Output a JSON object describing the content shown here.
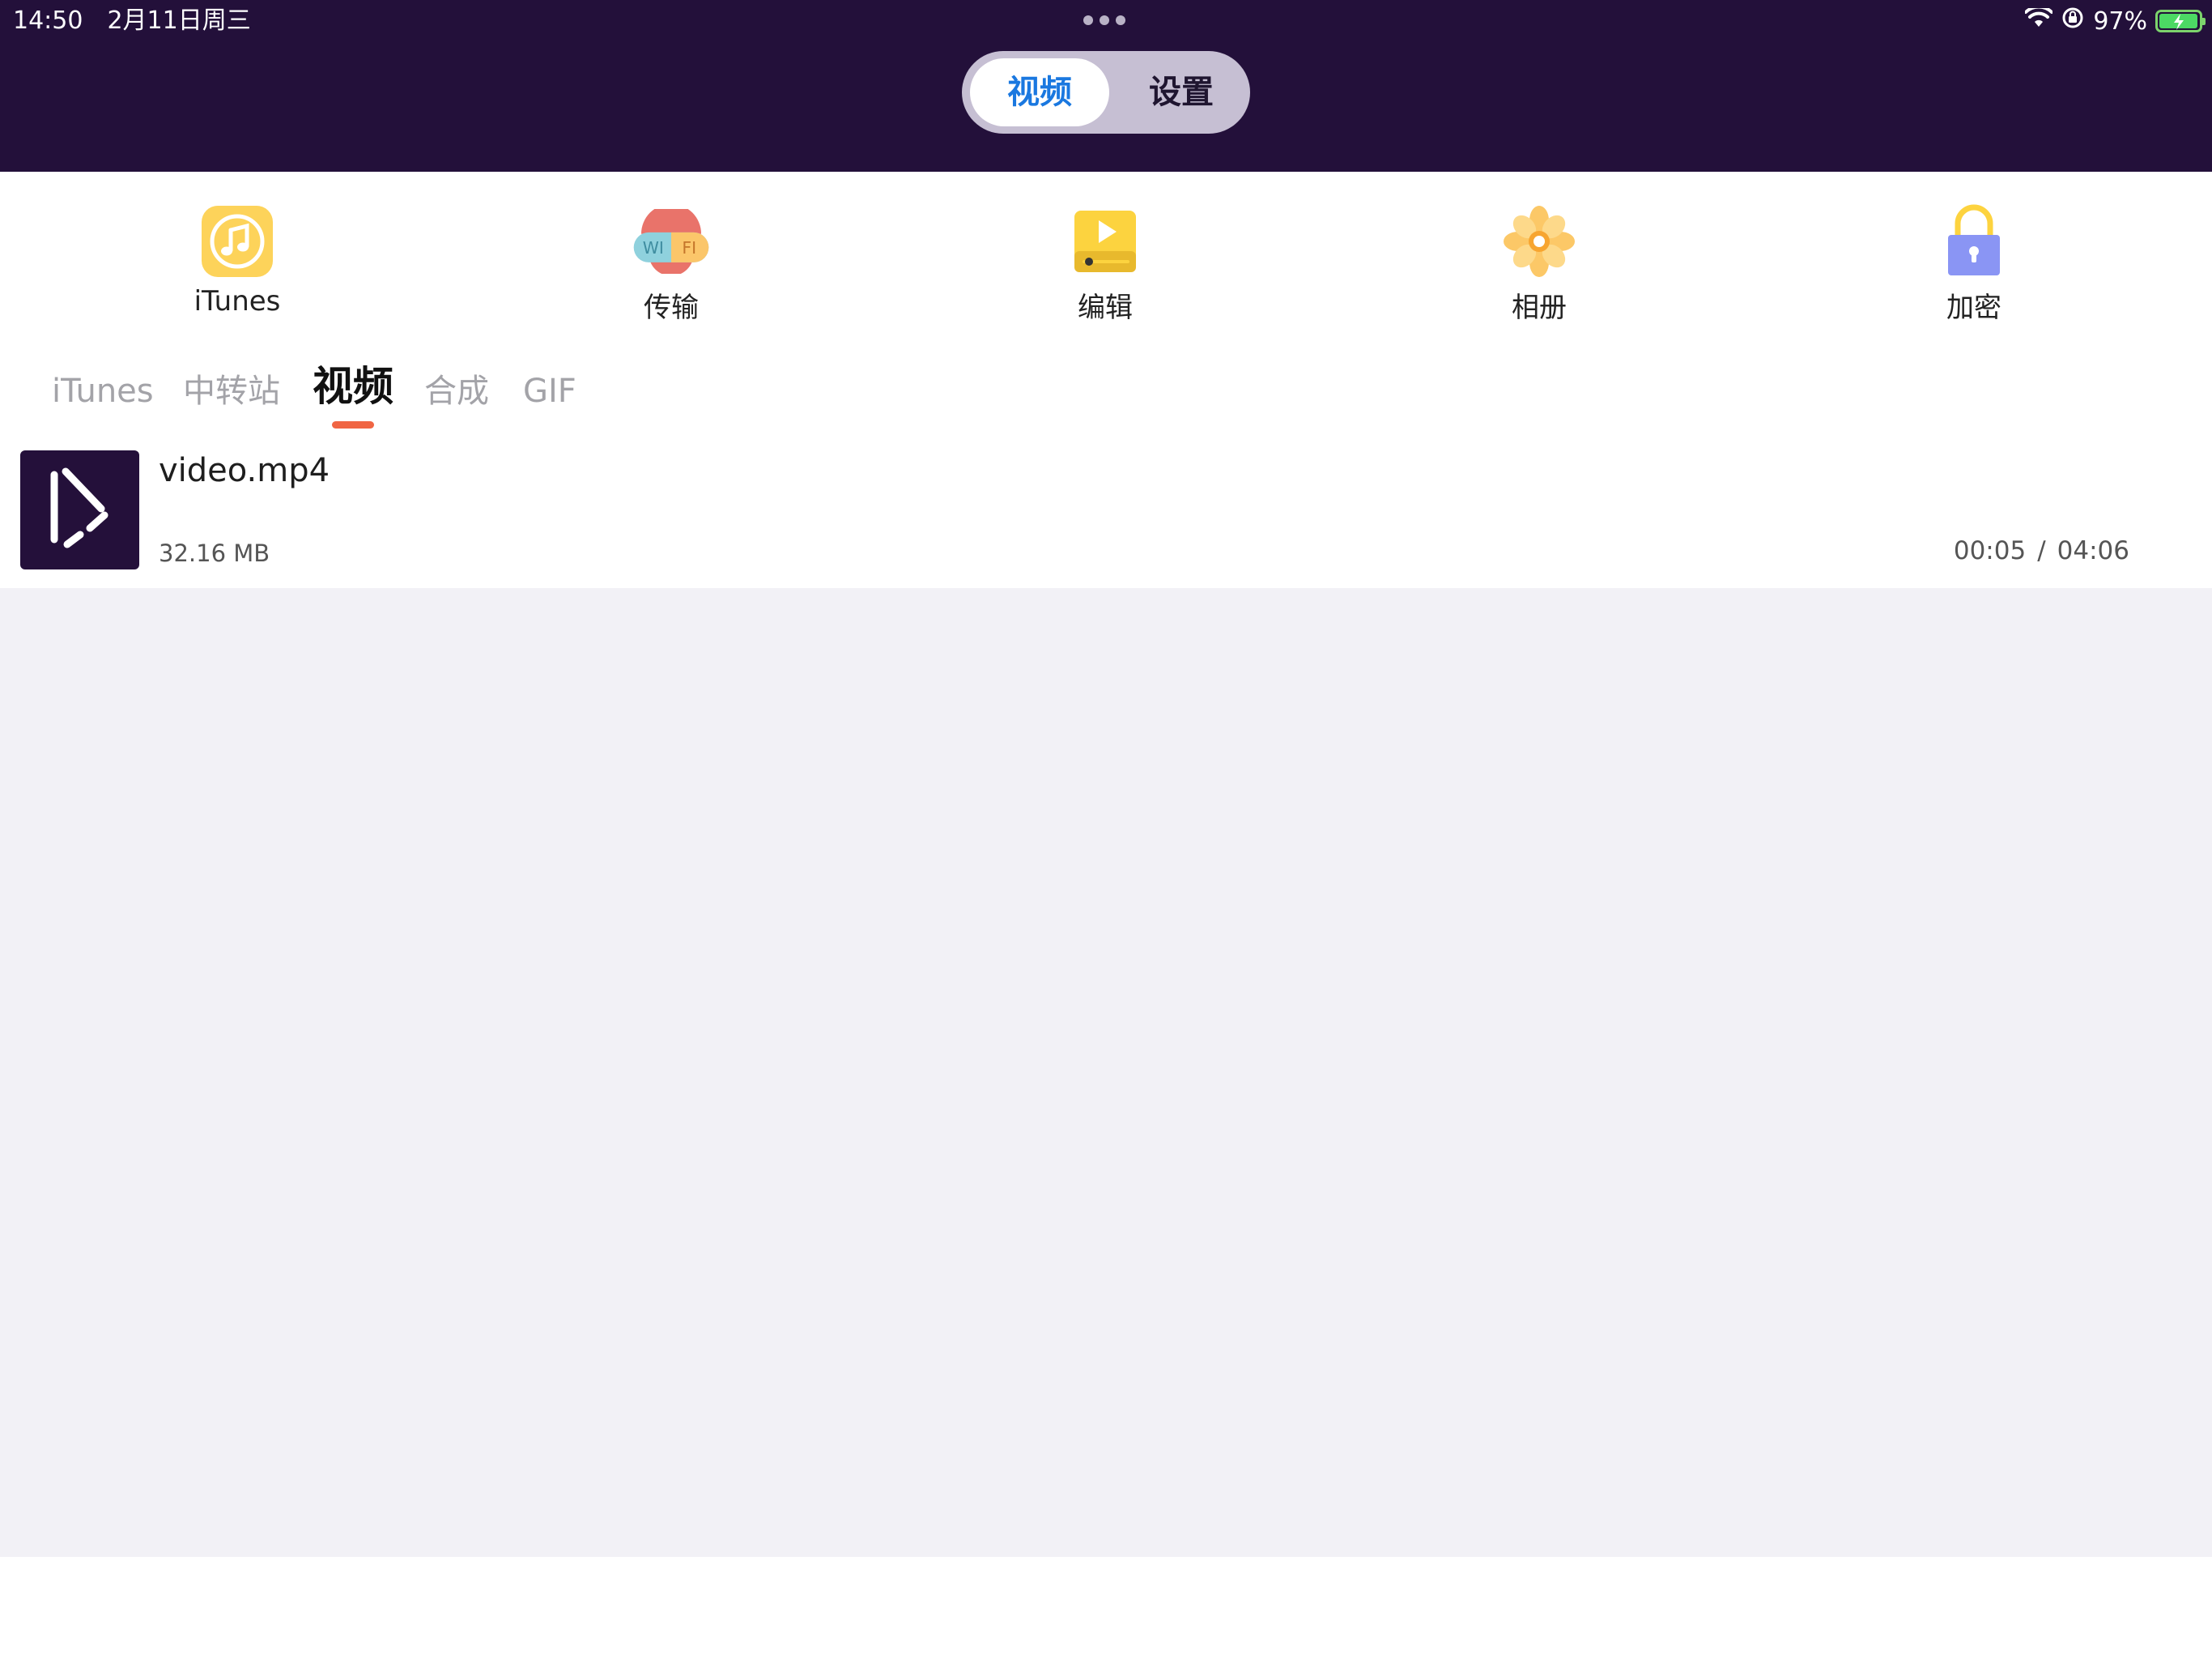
{
  "status_bar": {
    "time": "14:50",
    "date": "2月11日周三",
    "battery_percent": "97%",
    "battery_level": 0.97,
    "icons": [
      "wifi-icon",
      "orientation-lock-icon",
      "battery-charging-icon"
    ]
  },
  "segmented_control": {
    "video_label": "视频",
    "settings_label": "设置",
    "selected": "视频"
  },
  "toolbar": {
    "items": [
      {
        "label": "iTunes",
        "icon": "itunes-icon"
      },
      {
        "label": "传输",
        "icon": "wifi-transfer-icon"
      },
      {
        "label": "编辑",
        "icon": "edit-video-icon"
      },
      {
        "label": "相册",
        "icon": "photo-album-icon"
      },
      {
        "label": "加密",
        "icon": "lock-icon"
      }
    ],
    "wifi_badge_left": "WI",
    "wifi_badge_right": "FI"
  },
  "tabs": {
    "items": [
      "iTunes",
      "中转站",
      "视频",
      "合成",
      "GIF"
    ],
    "selected": "视频"
  },
  "files": [
    {
      "name": "video.mp4",
      "size": "32.16 MB",
      "position": "00:05",
      "separator": "/",
      "duration": "04:06"
    }
  ],
  "colors": {
    "header_bg": "#23103a",
    "accent_blue": "#1a78e0",
    "tab_underline": "#f06543",
    "empty_bg": "#f2f1f6"
  }
}
